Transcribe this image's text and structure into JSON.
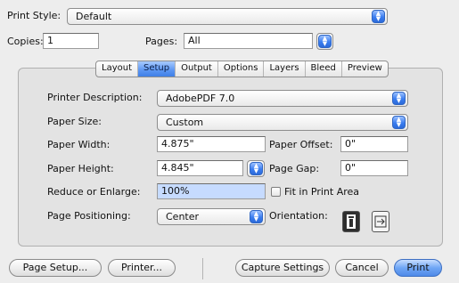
{
  "print_style": {
    "label": "Print Style:",
    "value": "Default"
  },
  "copies": {
    "label": "Copies:",
    "value": "1"
  },
  "pages": {
    "label": "Pages:",
    "value": "All"
  },
  "tabs": [
    {
      "label": "Layout"
    },
    {
      "label": "Setup",
      "active": true
    },
    {
      "label": "Output"
    },
    {
      "label": "Options"
    },
    {
      "label": "Layers"
    },
    {
      "label": "Bleed"
    },
    {
      "label": "Preview"
    }
  ],
  "setup": {
    "printer_description": {
      "label": "Printer Description:",
      "value": "AdobePDF 7.0"
    },
    "paper_size": {
      "label": "Paper Size:",
      "value": "Custom"
    },
    "paper_width": {
      "label": "Paper Width:",
      "value": "4.875\""
    },
    "paper_offset": {
      "label": "Paper Offset:",
      "value": "0\""
    },
    "paper_height": {
      "label": "Paper Height:",
      "value": "4.845\""
    },
    "page_gap": {
      "label": "Page Gap:",
      "value": "0\""
    },
    "reduce_enlarge": {
      "label": "Reduce or Enlarge:",
      "value": "100%"
    },
    "fit_in_print_area": {
      "label": "Fit in Print Area",
      "checked": false
    },
    "page_positioning": {
      "label": "Page Positioning:",
      "value": "Center"
    },
    "orientation": {
      "label": "Orientation:",
      "selected": "portrait"
    }
  },
  "buttons": {
    "page_setup": "Page Setup...",
    "printer": "Printer...",
    "capture_settings": "Capture Settings",
    "cancel": "Cancel",
    "print": "Print"
  },
  "colors": {
    "accent": "#5a95f2",
    "panel": "#e3e3e3",
    "window": "#ededed"
  }
}
